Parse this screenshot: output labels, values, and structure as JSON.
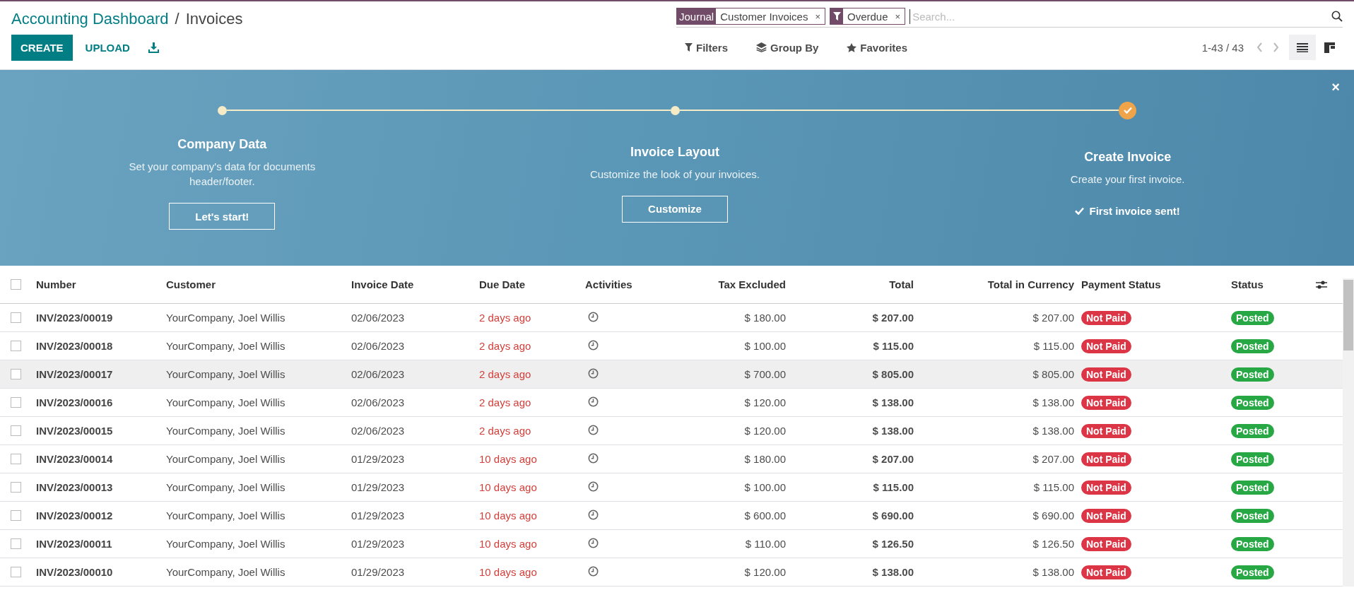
{
  "breadcrumb": {
    "parent": "Accounting Dashboard",
    "separator": "/",
    "current": "Invoices"
  },
  "actions": {
    "create": "CREATE",
    "upload": "UPLOAD"
  },
  "search": {
    "facets": [
      {
        "kind": "field",
        "label": "Journal",
        "value": "Customer Invoices",
        "remove": "×"
      },
      {
        "kind": "filter",
        "value": "Overdue",
        "remove": "×"
      }
    ],
    "placeholder": "Search..."
  },
  "search_options": [
    "Filters",
    "Group By",
    "Favorites"
  ],
  "pager": "1-43 / 43",
  "views": [
    {
      "kind": "list",
      "selected": true
    },
    {
      "kind": "kanban",
      "selected": false
    }
  ],
  "banner": {
    "close": "×",
    "steps": [
      {
        "title": "Company Data",
        "description": "Set your company's data for documents header/footer.",
        "button": "Let's start!",
        "done": false
      },
      {
        "title": "Invoice Layout",
        "description": "Customize the look of your invoices.",
        "button": "Customize",
        "done": false
      },
      {
        "title": "Create Invoice",
        "description": "Create your first invoice.",
        "done_label": "First invoice sent!",
        "done": true
      }
    ]
  },
  "table": {
    "header_checked": false,
    "columns": [
      "Number",
      "Customer",
      "Invoice Date",
      "Due Date",
      "Activities",
      "Tax Excluded",
      "Total",
      "Total in Currency",
      "Payment Status",
      "Status"
    ],
    "rows": [
      {
        "checked": false,
        "hovered": false,
        "number": "INV/2023/00019",
        "customer": "YourCompany, Joel Willis",
        "invoice_date": "02/06/2023",
        "due_date": "2 days ago",
        "overdue": true,
        "tax_excluded": "$ 180.00",
        "total": "$ 207.00",
        "total_in_currency": "$ 207.00",
        "payment_status": "Not Paid",
        "status": "Posted"
      },
      {
        "checked": false,
        "hovered": false,
        "number": "INV/2023/00018",
        "customer": "YourCompany, Joel Willis",
        "invoice_date": "02/06/2023",
        "due_date": "2 days ago",
        "overdue": true,
        "tax_excluded": "$ 100.00",
        "total": "$ 115.00",
        "total_in_currency": "$ 115.00",
        "payment_status": "Not Paid",
        "status": "Posted"
      },
      {
        "checked": false,
        "hovered": true,
        "number": "INV/2023/00017",
        "customer": "YourCompany, Joel Willis",
        "invoice_date": "02/06/2023",
        "due_date": "2 days ago",
        "overdue": true,
        "tax_excluded": "$ 700.00",
        "total": "$ 805.00",
        "total_in_currency": "$ 805.00",
        "payment_status": "Not Paid",
        "status": "Posted"
      },
      {
        "checked": false,
        "hovered": false,
        "number": "INV/2023/00016",
        "customer": "YourCompany, Joel Willis",
        "invoice_date": "02/06/2023",
        "due_date": "2 days ago",
        "overdue": true,
        "tax_excluded": "$ 120.00",
        "total": "$ 138.00",
        "total_in_currency": "$ 138.00",
        "payment_status": "Not Paid",
        "status": "Posted"
      },
      {
        "checked": false,
        "hovered": false,
        "number": "INV/2023/00015",
        "customer": "YourCompany, Joel Willis",
        "invoice_date": "02/06/2023",
        "due_date": "2 days ago",
        "overdue": true,
        "tax_excluded": "$ 120.00",
        "total": "$ 138.00",
        "total_in_currency": "$ 138.00",
        "payment_status": "Not Paid",
        "status": "Posted"
      },
      {
        "checked": false,
        "hovered": false,
        "number": "INV/2023/00014",
        "customer": "YourCompany, Joel Willis",
        "invoice_date": "01/29/2023",
        "due_date": "10 days ago",
        "overdue": true,
        "tax_excluded": "$ 180.00",
        "total": "$ 207.00",
        "total_in_currency": "$ 207.00",
        "payment_status": "Not Paid",
        "status": "Posted"
      },
      {
        "checked": false,
        "hovered": false,
        "number": "INV/2023/00013",
        "customer": "YourCompany, Joel Willis",
        "invoice_date": "01/29/2023",
        "due_date": "10 days ago",
        "overdue": true,
        "tax_excluded": "$ 100.00",
        "total": "$ 115.00",
        "total_in_currency": "$ 115.00",
        "payment_status": "Not Paid",
        "status": "Posted"
      },
      {
        "checked": false,
        "hovered": false,
        "number": "INV/2023/00012",
        "customer": "YourCompany, Joel Willis",
        "invoice_date": "01/29/2023",
        "due_date": "10 days ago",
        "overdue": true,
        "tax_excluded": "$ 600.00",
        "total": "$ 690.00",
        "total_in_currency": "$ 690.00",
        "payment_status": "Not Paid",
        "status": "Posted"
      },
      {
        "checked": false,
        "hovered": false,
        "number": "INV/2023/00011",
        "customer": "YourCompany, Joel Willis",
        "invoice_date": "01/29/2023",
        "due_date": "10 days ago",
        "overdue": true,
        "tax_excluded": "$ 110.00",
        "total": "$ 126.50",
        "total_in_currency": "$ 126.50",
        "payment_status": "Not Paid",
        "status": "Posted"
      },
      {
        "checked": false,
        "hovered": false,
        "number": "INV/2023/00010",
        "customer": "YourCompany, Joel Willis",
        "invoice_date": "01/29/2023",
        "due_date": "10 days ago",
        "overdue": true,
        "tax_excluded": "$ 120.00",
        "total": "$ 138.00",
        "total_in_currency": "$ 138.00",
        "payment_status": "Not Paid",
        "status": "Posted"
      }
    ]
  }
}
